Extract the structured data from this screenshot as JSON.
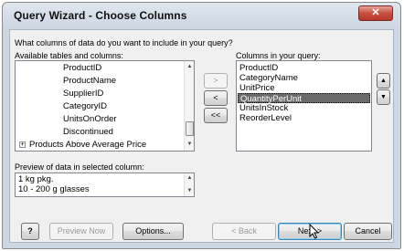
{
  "window": {
    "title": "Query Wizard - Choose Columns",
    "close_label": "✕"
  },
  "prompt": "What columns of data do you want to include in your query?",
  "available": {
    "label": "Available tables and columns:",
    "items": [
      "ProductID",
      "ProductName",
      "SupplierID",
      "CategoryID",
      "UnitsOnOrder",
      "Discontinued",
      "Products Above Average Price"
    ]
  },
  "query_columns": {
    "label": "Columns in your query:",
    "items": [
      "ProductID",
      "CategoryName",
      "UnitPrice",
      "QuantityPerUnit",
      "UnitsInStock",
      "ReorderLevel"
    ],
    "selected_index": 3
  },
  "move_buttons": {
    "add": ">",
    "remove": "<",
    "remove_all": "<<"
  },
  "preview": {
    "label": "Preview of data in selected column:",
    "items": [
      "1 kg pkg.",
      "10 - 200 g glasses"
    ]
  },
  "footer": {
    "help": "?",
    "preview_now": "Preview Now",
    "options": "Options...",
    "back": "< Back",
    "next": "Next >",
    "cancel": "Cancel"
  },
  "icons": {
    "help": "help-icon",
    "cursor": "mouse-pointer-icon",
    "expand": "tree-expand-icon"
  }
}
